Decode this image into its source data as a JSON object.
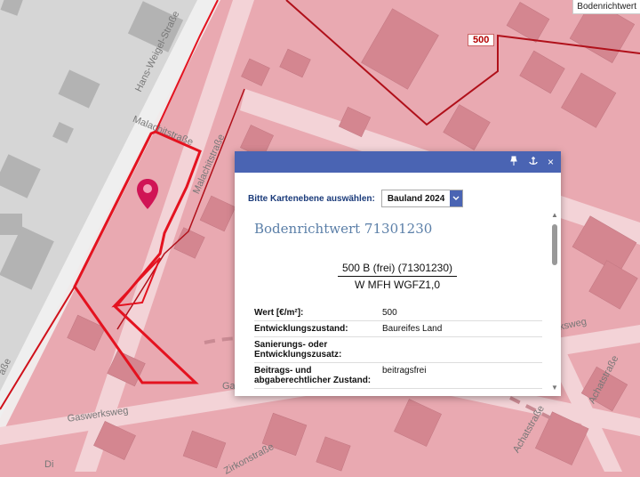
{
  "map": {
    "corner_label": "Bodenrichtwert",
    "value_label": "500",
    "streets": [
      "Hans-Weigel-Straße",
      "Malachitstraße",
      "Malachitstraße",
      "Gaswerksweg",
      "Zirkonstraße",
      "Achatstraße",
      "Achatstraße",
      "ksweg",
      "aße",
      "Di",
      "Ga"
    ]
  },
  "popup": {
    "layer_prompt": "Bitte Kartenebene auswählen:",
    "layer_value": "Bauland 2024",
    "title": "Bodenrichtwert 71301230",
    "fraction_top": "500 B (frei) (71301230)",
    "fraction_bottom": "W MFH WGFZ1,0",
    "rows": [
      {
        "key": "Wert [€/m²]:",
        "value": "500"
      },
      {
        "key": "Entwicklungszustand:",
        "value": "Baureifes Land"
      },
      {
        "key": "Sanierungs- oder Entwicklungszusatz:",
        "value": ""
      },
      {
        "key": "Beitrags- und abgaberechtlicher Zustand:",
        "value": "beitragsfrei"
      }
    ],
    "close_glyph": "×",
    "colors": {
      "header": "#4a64b3",
      "title": "#5b7fa8"
    }
  }
}
